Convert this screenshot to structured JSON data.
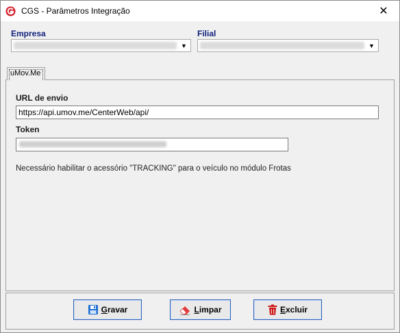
{
  "window": {
    "title": "CGS - Parâmetros Integração"
  },
  "filters": {
    "empresa_label": "Empresa",
    "filial_label": "Filial"
  },
  "tabs": [
    {
      "label": "uMov.Me"
    }
  ],
  "form": {
    "url_label": "URL de envio",
    "url_value": "https://api.umov.me/CenterWeb/api/",
    "token_label": "Token",
    "note": "Necessário habilitar o acessório \"TRACKING\" para o veículo no módulo Frotas"
  },
  "buttons": {
    "save_rest": "ravar",
    "save_key": "G",
    "clear_rest": "impar",
    "clear_key": "L",
    "delete_rest": "xcluir",
    "delete_key": "E"
  },
  "icons": [
    "app-logo-icon",
    "close-icon",
    "chevron-down-icon",
    "floppy-disk-icon",
    "eraser-icon",
    "trash-icon"
  ],
  "colors": {
    "label_blue": "#0f1f7a",
    "button_border": "#2b5fb5",
    "delete_red": "#cc1111"
  }
}
